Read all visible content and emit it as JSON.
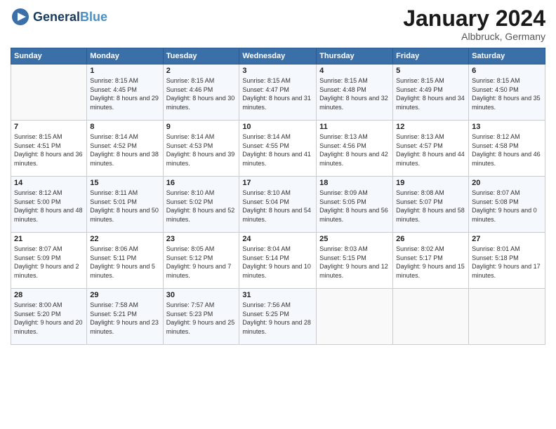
{
  "header": {
    "logo_general": "General",
    "logo_blue": "Blue",
    "month_title": "January 2024",
    "location": "Albbruck, Germany"
  },
  "days_of_week": [
    "Sunday",
    "Monday",
    "Tuesday",
    "Wednesday",
    "Thursday",
    "Friday",
    "Saturday"
  ],
  "weeks": [
    {
      "days": [
        {
          "num": "",
          "sunrise": "",
          "sunset": "",
          "daylight": ""
        },
        {
          "num": "1",
          "sunrise": "Sunrise: 8:15 AM",
          "sunset": "Sunset: 4:45 PM",
          "daylight": "Daylight: 8 hours and 29 minutes."
        },
        {
          "num": "2",
          "sunrise": "Sunrise: 8:15 AM",
          "sunset": "Sunset: 4:46 PM",
          "daylight": "Daylight: 8 hours and 30 minutes."
        },
        {
          "num": "3",
          "sunrise": "Sunrise: 8:15 AM",
          "sunset": "Sunset: 4:47 PM",
          "daylight": "Daylight: 8 hours and 31 minutes."
        },
        {
          "num": "4",
          "sunrise": "Sunrise: 8:15 AM",
          "sunset": "Sunset: 4:48 PM",
          "daylight": "Daylight: 8 hours and 32 minutes."
        },
        {
          "num": "5",
          "sunrise": "Sunrise: 8:15 AM",
          "sunset": "Sunset: 4:49 PM",
          "daylight": "Daylight: 8 hours and 34 minutes."
        },
        {
          "num": "6",
          "sunrise": "Sunrise: 8:15 AM",
          "sunset": "Sunset: 4:50 PM",
          "daylight": "Daylight: 8 hours and 35 minutes."
        }
      ]
    },
    {
      "days": [
        {
          "num": "7",
          "sunrise": "Sunrise: 8:15 AM",
          "sunset": "Sunset: 4:51 PM",
          "daylight": "Daylight: 8 hours and 36 minutes."
        },
        {
          "num": "8",
          "sunrise": "Sunrise: 8:14 AM",
          "sunset": "Sunset: 4:52 PM",
          "daylight": "Daylight: 8 hours and 38 minutes."
        },
        {
          "num": "9",
          "sunrise": "Sunrise: 8:14 AM",
          "sunset": "Sunset: 4:53 PM",
          "daylight": "Daylight: 8 hours and 39 minutes."
        },
        {
          "num": "10",
          "sunrise": "Sunrise: 8:14 AM",
          "sunset": "Sunset: 4:55 PM",
          "daylight": "Daylight: 8 hours and 41 minutes."
        },
        {
          "num": "11",
          "sunrise": "Sunrise: 8:13 AM",
          "sunset": "Sunset: 4:56 PM",
          "daylight": "Daylight: 8 hours and 42 minutes."
        },
        {
          "num": "12",
          "sunrise": "Sunrise: 8:13 AM",
          "sunset": "Sunset: 4:57 PM",
          "daylight": "Daylight: 8 hours and 44 minutes."
        },
        {
          "num": "13",
          "sunrise": "Sunrise: 8:12 AM",
          "sunset": "Sunset: 4:58 PM",
          "daylight": "Daylight: 8 hours and 46 minutes."
        }
      ]
    },
    {
      "days": [
        {
          "num": "14",
          "sunrise": "Sunrise: 8:12 AM",
          "sunset": "Sunset: 5:00 PM",
          "daylight": "Daylight: 8 hours and 48 minutes."
        },
        {
          "num": "15",
          "sunrise": "Sunrise: 8:11 AM",
          "sunset": "Sunset: 5:01 PM",
          "daylight": "Daylight: 8 hours and 50 minutes."
        },
        {
          "num": "16",
          "sunrise": "Sunrise: 8:10 AM",
          "sunset": "Sunset: 5:02 PM",
          "daylight": "Daylight: 8 hours and 52 minutes."
        },
        {
          "num": "17",
          "sunrise": "Sunrise: 8:10 AM",
          "sunset": "Sunset: 5:04 PM",
          "daylight": "Daylight: 8 hours and 54 minutes."
        },
        {
          "num": "18",
          "sunrise": "Sunrise: 8:09 AM",
          "sunset": "Sunset: 5:05 PM",
          "daylight": "Daylight: 8 hours and 56 minutes."
        },
        {
          "num": "19",
          "sunrise": "Sunrise: 8:08 AM",
          "sunset": "Sunset: 5:07 PM",
          "daylight": "Daylight: 8 hours and 58 minutes."
        },
        {
          "num": "20",
          "sunrise": "Sunrise: 8:07 AM",
          "sunset": "Sunset: 5:08 PM",
          "daylight": "Daylight: 9 hours and 0 minutes."
        }
      ]
    },
    {
      "days": [
        {
          "num": "21",
          "sunrise": "Sunrise: 8:07 AM",
          "sunset": "Sunset: 5:09 PM",
          "daylight": "Daylight: 9 hours and 2 minutes."
        },
        {
          "num": "22",
          "sunrise": "Sunrise: 8:06 AM",
          "sunset": "Sunset: 5:11 PM",
          "daylight": "Daylight: 9 hours and 5 minutes."
        },
        {
          "num": "23",
          "sunrise": "Sunrise: 8:05 AM",
          "sunset": "Sunset: 5:12 PM",
          "daylight": "Daylight: 9 hours and 7 minutes."
        },
        {
          "num": "24",
          "sunrise": "Sunrise: 8:04 AM",
          "sunset": "Sunset: 5:14 PM",
          "daylight": "Daylight: 9 hours and 10 minutes."
        },
        {
          "num": "25",
          "sunrise": "Sunrise: 8:03 AM",
          "sunset": "Sunset: 5:15 PM",
          "daylight": "Daylight: 9 hours and 12 minutes."
        },
        {
          "num": "26",
          "sunrise": "Sunrise: 8:02 AM",
          "sunset": "Sunset: 5:17 PM",
          "daylight": "Daylight: 9 hours and 15 minutes."
        },
        {
          "num": "27",
          "sunrise": "Sunrise: 8:01 AM",
          "sunset": "Sunset: 5:18 PM",
          "daylight": "Daylight: 9 hours and 17 minutes."
        }
      ]
    },
    {
      "days": [
        {
          "num": "28",
          "sunrise": "Sunrise: 8:00 AM",
          "sunset": "Sunset: 5:20 PM",
          "daylight": "Daylight: 9 hours and 20 minutes."
        },
        {
          "num": "29",
          "sunrise": "Sunrise: 7:58 AM",
          "sunset": "Sunset: 5:21 PM",
          "daylight": "Daylight: 9 hours and 23 minutes."
        },
        {
          "num": "30",
          "sunrise": "Sunrise: 7:57 AM",
          "sunset": "Sunset: 5:23 PM",
          "daylight": "Daylight: 9 hours and 25 minutes."
        },
        {
          "num": "31",
          "sunrise": "Sunrise: 7:56 AM",
          "sunset": "Sunset: 5:25 PM",
          "daylight": "Daylight: 9 hours and 28 minutes."
        },
        {
          "num": "",
          "sunrise": "",
          "sunset": "",
          "daylight": ""
        },
        {
          "num": "",
          "sunrise": "",
          "sunset": "",
          "daylight": ""
        },
        {
          "num": "",
          "sunrise": "",
          "sunset": "",
          "daylight": ""
        }
      ]
    }
  ]
}
